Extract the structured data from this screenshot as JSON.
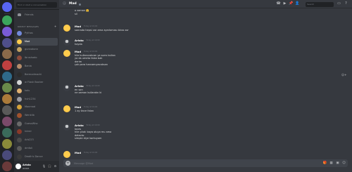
{
  "dm_sidebar": {
    "search_placeholder": "Find or start a conversation",
    "friends_label": "Friends",
    "section_header": "DIRECT MESSAGES",
    "add_label": "+",
    "items": [
      {
        "label": "Pythos",
        "color": "#7289da"
      },
      {
        "label": "Mad",
        "color": "#ffcc4d"
      },
      {
        "label": "gunnotonn",
        "color": "#c0a060"
      },
      {
        "label": "Ibrushado",
        "color": "#8b4a3a"
      },
      {
        "label": "Bania",
        "color": "#b48c6a"
      },
      {
        "label": "Bermodmachi",
        "color": "#2c2c2c"
      },
      {
        "label": "w Flash Basher",
        "color": "#d4d4d4"
      },
      {
        "label": "kalu",
        "color": "#e0b070"
      },
      {
        "label": "huh1234",
        "color": "#9a9aa0"
      },
      {
        "label": "Monmad",
        "color": "#d4a23a"
      },
      {
        "label": "Wenklib",
        "color": "#a0522d"
      },
      {
        "label": "GuessWho",
        "color": "#6a6a6a"
      },
      {
        "label": "Iviner",
        "color": "#8a3a2a"
      },
      {
        "label": "Arb223",
        "color": "#4a4a4a"
      },
      {
        "label": "dmfoli",
        "color": "#5a5a5a"
      },
      {
        "label": "Death's Dance",
        "color": "#3a3a3a"
      }
    ]
  },
  "guilds": [
    {
      "color": "#5865f2"
    },
    {
      "color": "#3ba55c"
    },
    {
      "color": "#7a5cd6"
    },
    {
      "color": "#4f4f8a"
    },
    {
      "color": "#8a6a4a"
    },
    {
      "color": "#c04040"
    },
    {
      "color": "#2f6a8a"
    },
    {
      "color": "#6a8a4a"
    },
    {
      "color": "#aa7a3a"
    },
    {
      "color": "#5a5a5a"
    },
    {
      "color": "#7a4a6a"
    },
    {
      "color": "#3a6a5a"
    },
    {
      "color": "#8a8a3a"
    },
    {
      "color": "#4a4a7a"
    },
    {
      "color": "#6a3a3a"
    },
    {
      "color": "#3a3a3a"
    },
    {
      "color": "#5a7a8a"
    },
    {
      "color": "#8a5a3a"
    },
    {
      "color": "#4a6a4a"
    },
    {
      "color": "#6a6a6a"
    }
  ],
  "user_panel": {
    "name": "Aristo",
    "tag": "#0965",
    "mic_icon": "microphone-icon",
    "headset_icon": "headphones-icon",
    "settings_icon": "gear-icon"
  },
  "header": {
    "at_symbol": "@",
    "username": "Mad",
    "search_placeholder": "Search",
    "icons": [
      "phone-icon",
      "video-icon",
      "pin-icon",
      "add-member-icon",
      "inbox-icon",
      "help-icon"
    ]
  },
  "messages": [
    {
      "type": "continuation",
      "lines": [
        "o zaman 🤗",
        "sil"
      ]
    },
    {
      "type": "group",
      "author": "Mad",
      "time": "Today at 19:00",
      "avatar": "laugh",
      "lines": [
        "sonrada hepsi var ama ayarlaması biraz zor"
      ]
    },
    {
      "type": "group",
      "author": "Aristo",
      "time": "Today at 19:00",
      "avatar": "dark",
      "lines": [
        "hayda"
      ]
    },
    {
      "type": "group",
      "author": "Mad",
      "time": "Today at 19:00",
      "avatar": "laugh",
      "lines": [
        "hile kullanıcakcan ya sorrs kullan",
        "ya da umeta falan bak",
        "derim",
        "çok para harcamıyacaksan"
      ]
    },
    {
      "type": "group",
      "author": "Aristo",
      "time": "Today at 19:00",
      "avatar": "dark",
      "lines": [
        "en son",
        "ne zaman kullandın ki"
      ]
    },
    {
      "type": "group",
      "author": "Mad",
      "time": "Today at 19:00",
      "avatar": "laugh",
      "lines": [
        "1 ay önce falan"
      ]
    },
    {
      "type": "group",
      "author": "Aristo",
      "time": "Today at 19:00",
      "avatar": "dark",
      "lines": [
        "Ioves",
        "hile çıkalı baya oluyo mu ama",
        "detecto",
        "simple diye korkuyom"
      ]
    },
    {
      "type": "group",
      "author": "Mad",
      "time": "Today at 19:00",
      "avatar": "laugh",
      "lines": [
        ""
      ]
    }
  ],
  "reaction_icon": "add-reaction-icon",
  "composer": {
    "placeholder": "Message @Mad",
    "icons": [
      "gift-icon",
      "gif-icon",
      "sticker-icon",
      "emoji-icon"
    ]
  },
  "colors": {
    "blurple": "#5865f2",
    "bg_chat": "#36393f",
    "bg_sidebar": "#2f3136",
    "bg_guilds": "#202225",
    "text_normal": "#dcddde",
    "text_muted": "#72767d"
  }
}
